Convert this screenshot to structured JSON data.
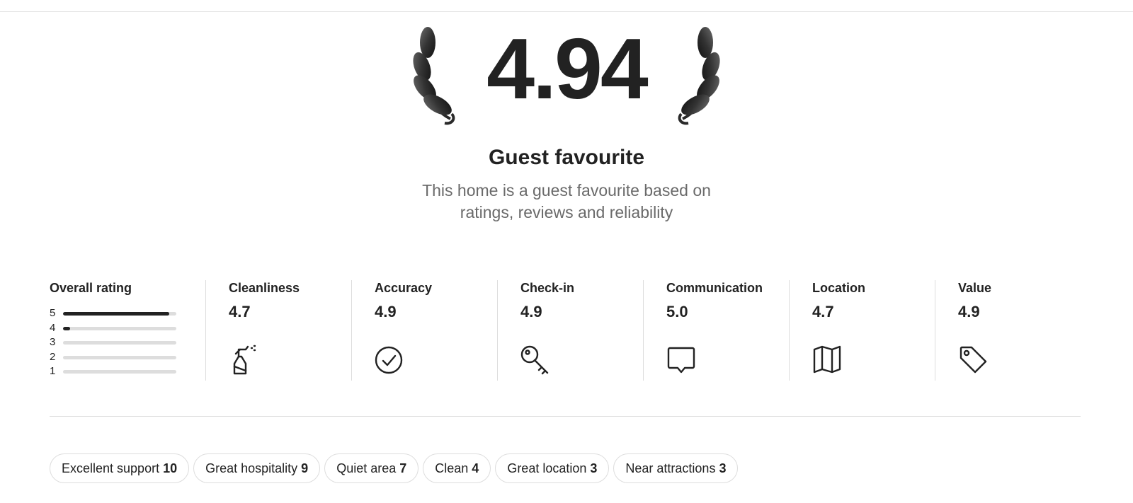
{
  "hero": {
    "rating": "4.94",
    "badge_title": "Guest favourite",
    "badge_subtitle": "This home is a guest favourite based on ratings, reviews and reliability"
  },
  "overall": {
    "title": "Overall rating",
    "distribution": [
      {
        "stars": "5",
        "fraction": 0.94
      },
      {
        "stars": "4",
        "fraction": 0.06
      },
      {
        "stars": "3",
        "fraction": 0
      },
      {
        "stars": "2",
        "fraction": 0
      },
      {
        "stars": "1",
        "fraction": 0
      }
    ]
  },
  "categories": [
    {
      "label": "Cleanliness",
      "value": "4.7",
      "icon": "spray-bottle-icon"
    },
    {
      "label": "Accuracy",
      "value": "4.9",
      "icon": "check-circle-icon"
    },
    {
      "label": "Check-in",
      "value": "4.9",
      "icon": "key-icon"
    },
    {
      "label": "Communication",
      "value": "5.0",
      "icon": "chat-bubble-icon"
    },
    {
      "label": "Location",
      "value": "4.7",
      "icon": "map-icon"
    },
    {
      "label": "Value",
      "value": "4.9",
      "icon": "price-tag-icon"
    }
  ],
  "tags": [
    {
      "label": "Excellent support",
      "count": "10"
    },
    {
      "label": "Great hospitality",
      "count": "9"
    },
    {
      "label": "Quiet area",
      "count": "7"
    },
    {
      "label": "Clean",
      "count": "4"
    },
    {
      "label": "Great location",
      "count": "3"
    },
    {
      "label": "Near attractions",
      "count": "3"
    }
  ],
  "colors": {
    "text": "#222222",
    "muted": "#6a6a6a",
    "divider": "#dddddd",
    "bar_track": "#dddddd",
    "bar_fill": "#222222"
  }
}
